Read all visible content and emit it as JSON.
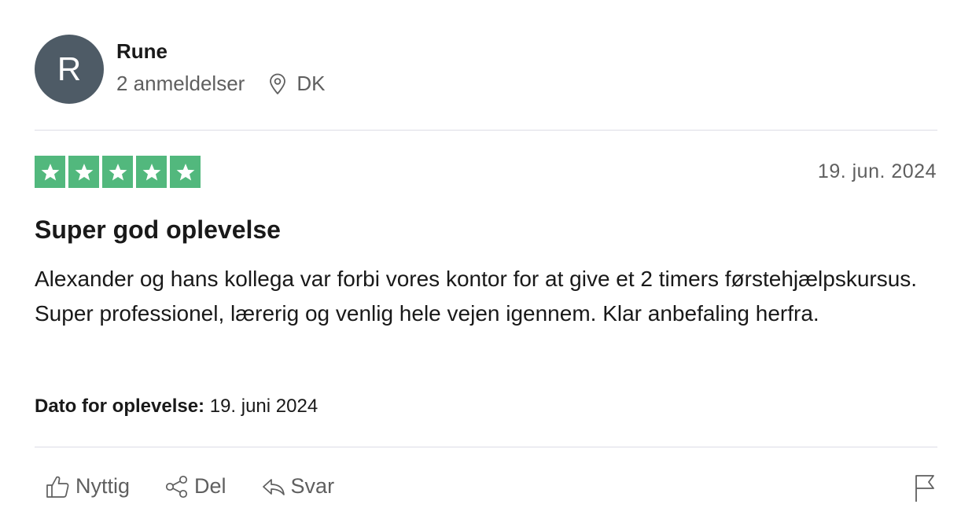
{
  "reviewer": {
    "initial": "R",
    "name": "Rune",
    "review_count": "2 anmeldelser",
    "country": "DK"
  },
  "review": {
    "rating": 5,
    "rating_color": "#52b87d",
    "date": "19. jun. 2024",
    "title": "Super god oplevelse",
    "body": "Alexander og hans kollega var forbi vores kontor for at give et 2 timers førstehjælpskursus. Super professionel, lærerig og venlig hele vejen igennem. Klar anbefaling herfra.",
    "experience_label": "Dato for oplevelse:",
    "experience_date": "19. juni 2024"
  },
  "actions": {
    "useful": "Nyttig",
    "share": "Del",
    "reply": "Svar"
  },
  "icons": {
    "location": "location-pin-icon",
    "useful": "thumbs-up-icon",
    "share": "share-icon",
    "reply": "reply-icon",
    "report": "flag-icon"
  }
}
